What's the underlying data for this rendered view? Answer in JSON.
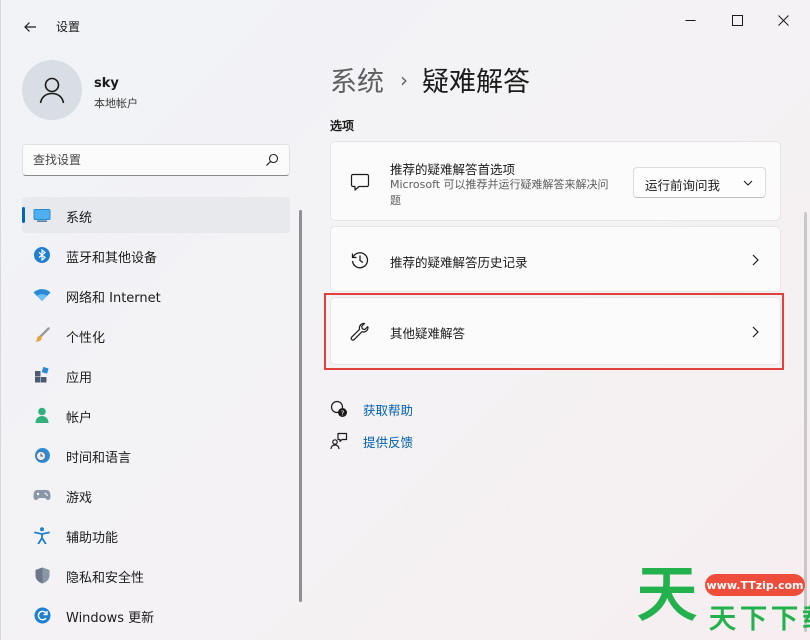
{
  "window": {
    "title": "设置",
    "controls": [
      "minimize-icon",
      "maximize-icon",
      "close-icon"
    ]
  },
  "profile": {
    "name": "sky",
    "account_type": "本地帐户"
  },
  "search": {
    "placeholder": "查找设置"
  },
  "sidebar": {
    "items": [
      {
        "label": "系统",
        "icon": "monitor-icon",
        "active": true
      },
      {
        "label": "蓝牙和其他设备",
        "icon": "bluetooth-icon",
        "active": false
      },
      {
        "label": "网络和 Internet",
        "icon": "wifi-icon",
        "active": false
      },
      {
        "label": "个性化",
        "icon": "paint-brush-icon",
        "active": false
      },
      {
        "label": "应用",
        "icon": "apps-icon",
        "active": false
      },
      {
        "label": "帐户",
        "icon": "person-icon",
        "active": false
      },
      {
        "label": "时间和语言",
        "icon": "clock-globe-icon",
        "active": false
      },
      {
        "label": "游戏",
        "icon": "gamepad-icon",
        "active": false
      },
      {
        "label": "辅助功能",
        "icon": "accessibility-icon",
        "active": false
      },
      {
        "label": "隐私和安全性",
        "icon": "shield-icon",
        "active": false
      },
      {
        "label": "Windows 更新",
        "icon": "update-icon",
        "active": false
      }
    ]
  },
  "breadcrumb": {
    "parent": "系统",
    "separator": "›",
    "current": "疑难解答"
  },
  "main": {
    "section_label": "选项",
    "cards": [
      {
        "title": "推荐的疑难解答首选项",
        "description": "Microsoft 可以推荐并运行疑难解答来解决问题",
        "icon": "chat-bubble-icon",
        "dropdown_value": "运行前询问我"
      },
      {
        "title": "推荐的疑难解答历史记录",
        "icon": "history-icon"
      },
      {
        "title": "其他疑难解答",
        "icon": "wrench-icon",
        "highlighted": true
      }
    ],
    "links": [
      {
        "label": "获取帮助",
        "icon": "help-icon"
      },
      {
        "label": "提供反馈",
        "icon": "feedback-icon"
      }
    ]
  },
  "watermark": {
    "big_char": "天",
    "url": "www.TTzip.com",
    "text": "天下下载"
  },
  "colors": {
    "accent": "#0067c0",
    "link": "#005fb8",
    "highlight_border": "#e0413b",
    "watermark_green": "#23b14d",
    "watermark_red": "#ef4d3c"
  }
}
